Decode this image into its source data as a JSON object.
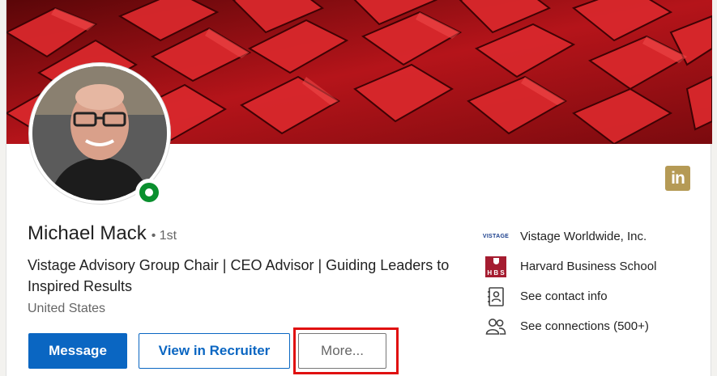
{
  "profile": {
    "name": "Michael Mack",
    "degree": "• 1st",
    "headline": "Vistage Advisory Group Chair | CEO Advisor | Guiding Leaders to Inspired Results",
    "location": "United States"
  },
  "actions": {
    "message_label": "Message",
    "recruiter_label": "View in Recruiter",
    "more_label": "More..."
  },
  "logo": {
    "text": "in",
    "color": "#b59a55"
  },
  "sidebar": {
    "items": [
      {
        "icon": "vistage-logo",
        "logo_text": "VISTAGE",
        "label": "Vistage Worldwide, Inc."
      },
      {
        "icon": "hbs-logo",
        "logo_text": "H B S",
        "label": "Harvard Business School"
      },
      {
        "icon": "contact-card-icon",
        "label": "See contact info"
      },
      {
        "icon": "people-icon",
        "label": "See connections (500+)"
      }
    ]
  },
  "colors": {
    "primary": "#0a66c2",
    "online": "#0a8f2e",
    "highlight": "#e01010",
    "hbs": "#a51c30"
  }
}
